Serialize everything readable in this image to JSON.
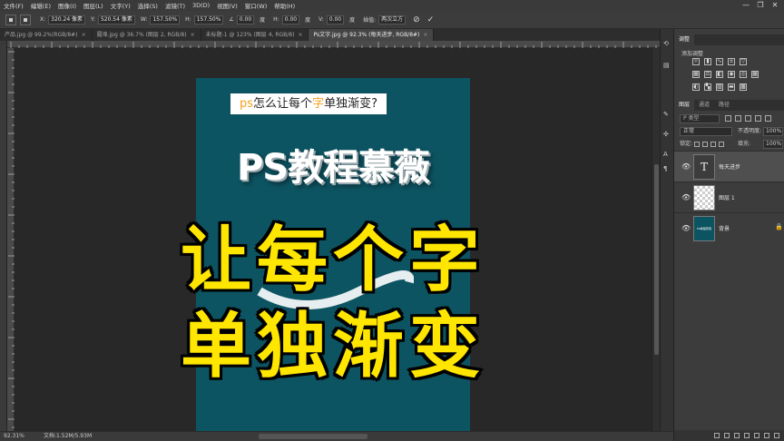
{
  "menu": [
    "文件(F)",
    "编辑(E)",
    "图像(I)",
    "图层(L)",
    "文字(Y)",
    "选择(S)",
    "滤镜(T)",
    "3D(D)",
    "视图(V)",
    "窗口(W)",
    "帮助(H)"
  ],
  "window_controls": [
    "—",
    "❐",
    "✕"
  ],
  "options": {
    "x_label": "X:",
    "x_value": "320.24 像素",
    "y_label": "Y:",
    "y_value": "520.54 像素",
    "w_label": "W:",
    "w_value": "157.50%",
    "h_label": "H:",
    "h_value": "157.50%",
    "angle_value": "0.00",
    "h_skew_label": "H:",
    "h_skew_value": "0.00",
    "v_skew_label": "V:",
    "v_skew_value": "0.00",
    "skew_unit": "度",
    "interp_label": "插值:",
    "interp_value": "两次立方",
    "cancel_symbol": "⊘",
    "commit_symbol": "✓"
  },
  "tabs": [
    {
      "label": "产品.jpg @ 99.2%(RGB/8#)",
      "close": "×"
    },
    {
      "label": "履埠.jpg @ 36.7% (图层 2, RGB/8)",
      "close": "×"
    },
    {
      "label": "未标题-1 @ 123% (图层 4, RGB/8)",
      "close": "×"
    },
    {
      "label": "Ps文字.jpg @ 92.3% (每天进步, RGB/8#)",
      "close": "×"
    }
  ],
  "canvas": {
    "caption_prefix": "ps",
    "caption_mid": "怎么让每个",
    "caption_highlight": "字",
    "caption_suffix": "单独渐变?",
    "brand": "PS教程慕薇",
    "headline_line1": "让每个字",
    "headline_line2": "单独渐变",
    "bg_color": "#0d5462",
    "headline_color": "#ffe600",
    "highlight_color": "#f5a11b"
  },
  "status": {
    "zoom": "92.31%",
    "doc": "文档:1.52M/5.93M"
  },
  "panels": {
    "adjust_tab": "调整",
    "add_adjust": "添加调整",
    "layer_tabs": [
      "图层",
      "通道",
      "路径"
    ],
    "search_placeholder": "P 类型",
    "blend_mode": "正常",
    "opacity_label": "不透明度:",
    "opacity_value": "100%",
    "lock_label": "锁定:",
    "fill_label": "填充:",
    "fill_value": "100%",
    "layers": [
      {
        "name": "每天进步",
        "thumb": "T",
        "eye": "👁",
        "lock": ""
      },
      {
        "name": "图层 1",
        "thumb": "",
        "eye": "👁",
        "lock": ""
      },
      {
        "name": "背景",
        "thumb": "PS教程慕薇",
        "eye": "👁",
        "lock": "🔒"
      }
    ]
  }
}
